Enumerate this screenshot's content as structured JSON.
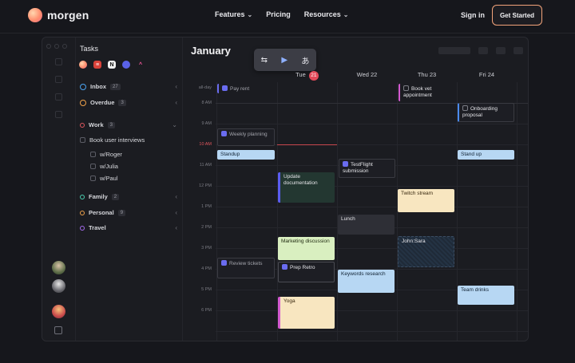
{
  "nav": {
    "brand": "morgen",
    "links": [
      {
        "label": "Features",
        "dropdown": true
      },
      {
        "label": "Pricing",
        "dropdown": false
      },
      {
        "label": "Resources",
        "dropdown": true
      }
    ],
    "sign_in": "Sign in",
    "cta": "Get Started"
  },
  "tasks": {
    "title": "Tasks",
    "providers": [
      "morgen-icon",
      "todoist-icon",
      "notion-icon",
      "linear-icon",
      "clickup-icon"
    ],
    "lists": [
      {
        "label": "Inbox",
        "count": "27",
        "color": "#4aa3f0"
      },
      {
        "label": "Overdue",
        "count": "3",
        "color": "#f0a24a"
      },
      {
        "label": "Work",
        "count": "3",
        "color": "#e0565e"
      },
      {
        "label": "Book user interviews",
        "sub": [
          "w/Roger",
          "w/Julia",
          "w/Paul"
        ]
      },
      {
        "label": "Family",
        "count": "2",
        "color": "#4ad0b0"
      },
      {
        "label": "Personal",
        "count": "9",
        "color": "#f0a24a"
      },
      {
        "label": "Travel",
        "count": "",
        "color": "#a66cf0"
      }
    ]
  },
  "calendar": {
    "month": "January",
    "toolbar": [
      "sync-icon",
      "video-icon",
      "translate-icon"
    ],
    "days": [
      {
        "name": "Tue",
        "num": "21",
        "today": true
      },
      {
        "name": "Wed 22",
        "num": "",
        "today": false
      },
      {
        "name": "Thu 23",
        "num": "",
        "today": false
      },
      {
        "name": "Fri 24",
        "num": "",
        "today": false
      }
    ],
    "hours": [
      "all-day",
      "8 AM",
      "9 AM",
      "10 AM",
      "11 AM",
      "12 PM",
      "1 PM",
      "2 PM",
      "3 PM",
      "4 PM",
      "5 PM",
      "6 PM"
    ],
    "now_label": "10 AM",
    "events": [
      {
        "title": "Pay rent",
        "task": true
      },
      {
        "title": "Book vet appointment",
        "task": true
      },
      {
        "title": "Onboarding proposal",
        "task": true
      },
      {
        "title": "Weekly planning",
        "task": true
      },
      {
        "title": "Standup"
      },
      {
        "title": "Stand up"
      },
      {
        "title": "TestFlight submission",
        "task": true
      },
      {
        "title": "Update documentation"
      },
      {
        "title": "Twitch stream"
      },
      {
        "title": "Lunch"
      },
      {
        "title": "John:Sara"
      },
      {
        "title": "Marketing discussion"
      },
      {
        "title": "Review tickets",
        "task": true
      },
      {
        "title": "Prep Retro",
        "task": true
      },
      {
        "title": "Keywords research"
      },
      {
        "title": "Team drinks"
      },
      {
        "title": "Yoga"
      }
    ]
  }
}
